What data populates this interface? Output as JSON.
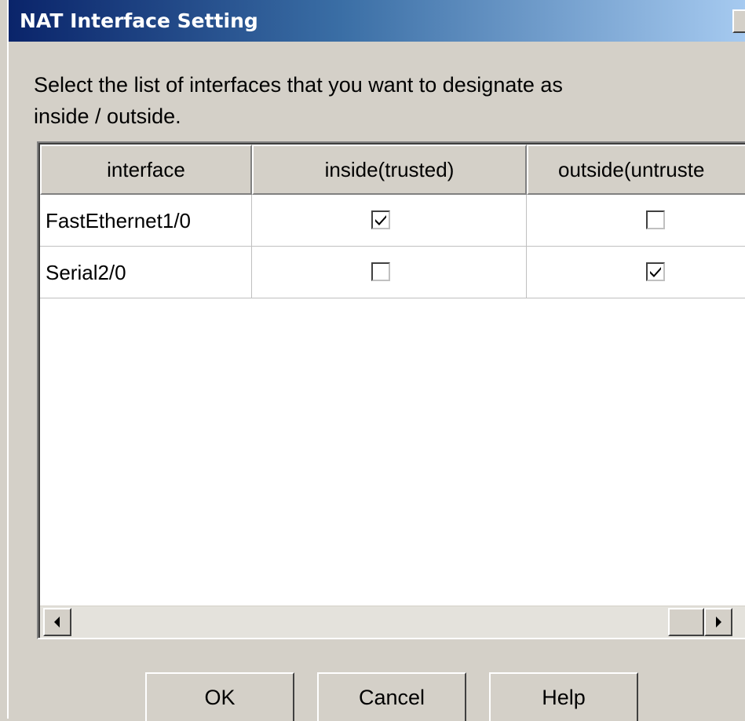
{
  "window": {
    "title": "NAT Interface Setting"
  },
  "instructions": "Select the list of interfaces that you want to designate as\ninside / outside.",
  "table": {
    "columns": [
      "interface",
      "inside(trusted)",
      "outside(untruste"
    ],
    "rows": [
      {
        "interface": "FastEthernet1/0",
        "inside": true,
        "outside": false
      },
      {
        "interface": "Serial2/0",
        "inside": false,
        "outside": true
      }
    ]
  },
  "buttons": {
    "ok": "OK",
    "cancel": "Cancel",
    "help": "Help"
  },
  "icons": {
    "checkmark": "check-icon",
    "left_arrow": "arrow-left-icon",
    "right_arrow": "arrow-right-icon",
    "close": "close-icon"
  },
  "colors": {
    "titlebar_start": "#0a246a",
    "titlebar_end": "#a6caf0",
    "face": "#d4d0c8"
  }
}
